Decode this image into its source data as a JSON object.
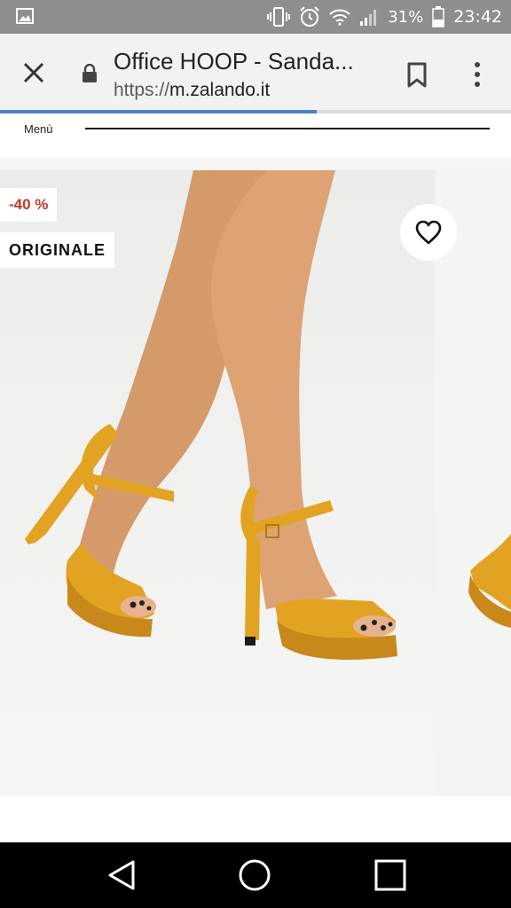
{
  "status_bar": {
    "battery_percent": "31%",
    "time": "23:42",
    "icons": [
      "gallery-icon",
      "vibrate-icon",
      "alarm-icon",
      "wifi-icon",
      "signal-icon",
      "battery-icon"
    ]
  },
  "browser": {
    "page_title": "Office HOOP - Sanda...",
    "url_scheme": "https://",
    "url_host": "m.zalando.it",
    "load_progress": 0.62,
    "accent_color": "#4b7fcb"
  },
  "site_nav": {
    "menu_label": "Menù"
  },
  "product": {
    "discount_badge": "-40 %",
    "origin_badge": "ORIGINALE",
    "badge_discount_color": "#c0392b",
    "shoe_color": "#e2a323"
  },
  "system_nav": {
    "buttons": [
      "back-icon",
      "home-icon",
      "recents-icon"
    ]
  }
}
